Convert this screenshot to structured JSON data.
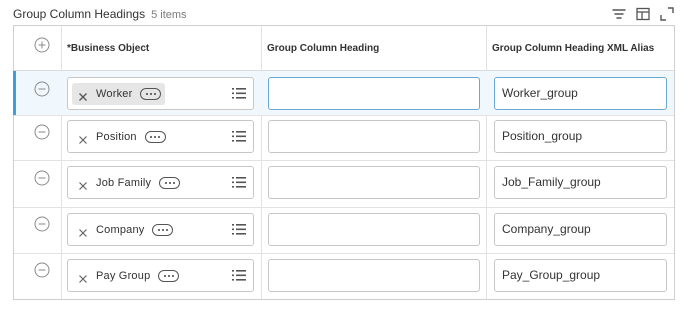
{
  "header": {
    "title": "Group Column Headings",
    "count": "5 items",
    "tools": [
      "filter-icon",
      "columns-icon",
      "expand-icon"
    ]
  },
  "columns": {
    "business_object": "*Business Object",
    "heading": "Group Column Heading",
    "alias": "Group Column Heading XML Alias"
  },
  "rows": [
    {
      "business_object": "Worker",
      "heading": "",
      "alias": "Worker_group",
      "selected": true
    },
    {
      "business_object": "Position",
      "heading": "",
      "alias": "Position_group",
      "selected": false
    },
    {
      "business_object": "Job Family",
      "heading": "",
      "alias": "Job_Family_group",
      "selected": false
    },
    {
      "business_object": "Company",
      "heading": "",
      "alias": "Company_group",
      "selected": false
    },
    {
      "business_object": "Pay Group",
      "heading": "",
      "alias": "Pay_Group_group",
      "selected": false
    }
  ],
  "colors": {
    "accent": "#3aa0e0",
    "selected_row": "#f1f8fd",
    "border": "#c7c7c7"
  }
}
